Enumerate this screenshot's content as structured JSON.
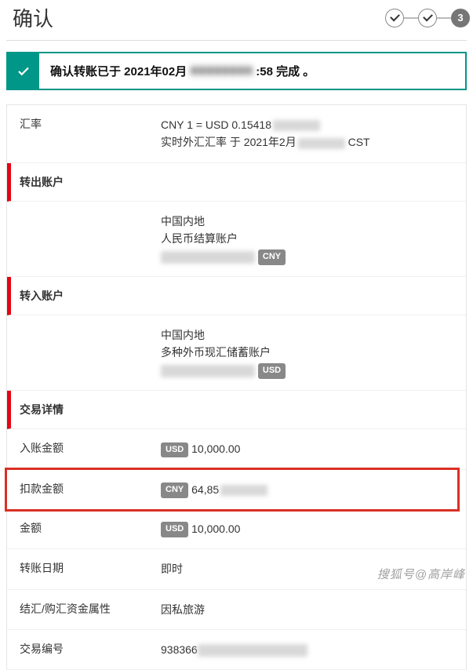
{
  "header": {
    "title": "确认",
    "step3": "3"
  },
  "banner": {
    "prefix": "确认转账已于 2021年02月",
    "hidden": "XXXXXXXX",
    "suffix": ":58 完成 。"
  },
  "rate": {
    "label": "汇率",
    "line1_prefix": "CNY 1 = USD 0.15418",
    "line2_prefix": "实时外汇汇率 于 2021年2月",
    "line2_suffix": " CST"
  },
  "from": {
    "section": "转出账户",
    "region": "中国内地",
    "type": "人民币结算账户",
    "ccy": "CNY"
  },
  "to": {
    "section": "转入账户",
    "region": "中国内地",
    "type": "多种外币现汇储蓄账户",
    "ccy": "USD"
  },
  "details": {
    "section": "交易详情",
    "credit_label": "入账金额",
    "credit_ccy": "USD",
    "credit_amt": "10,000.00",
    "debit_label": "扣款金额",
    "debit_ccy": "CNY",
    "debit_amt_prefix": "64,85",
    "amount_label": "金额",
    "amount_ccy": "USD",
    "amount_amt": "10,000.00",
    "date_label": "转账日期",
    "date_val": "即时",
    "purpose_label": "结汇/购汇资金属性",
    "purpose_val": "因私旅游",
    "ref_label": "交易编号",
    "ref_prefix": "938366"
  },
  "watermark": "搜狐号@高岸峰"
}
